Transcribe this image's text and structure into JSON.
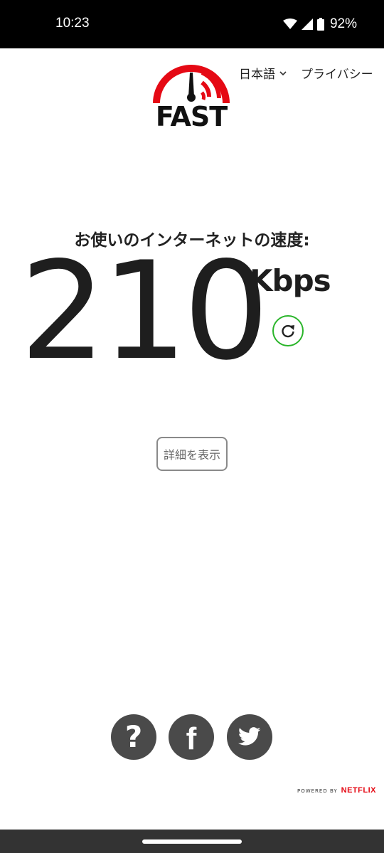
{
  "status_bar": {
    "time": "10:23",
    "battery": "92%"
  },
  "header": {
    "logo_text": "FAST",
    "language_label": "日本語",
    "privacy_label": "プライバシー"
  },
  "speed": {
    "label": "お使いのインターネットの速度:",
    "value": "210",
    "unit": "Kbps"
  },
  "details_button_label": "詳細を表示",
  "footer": {
    "help_glyph": "?",
    "facebook_glyph": "f",
    "powered_by": "POWERED BY",
    "brand": "NETFLIX"
  },
  "colors": {
    "accent_red": "#e50914",
    "refresh_green": "#2ab52a",
    "social_gray": "#4a4a4a"
  },
  "icons": {
    "refresh": "refresh-icon",
    "language_dropdown": "chevron-down-icon",
    "twitter": "twitter-bird-icon",
    "wifi": "wifi-icon",
    "signal": "signal-icon",
    "battery": "battery-icon"
  }
}
